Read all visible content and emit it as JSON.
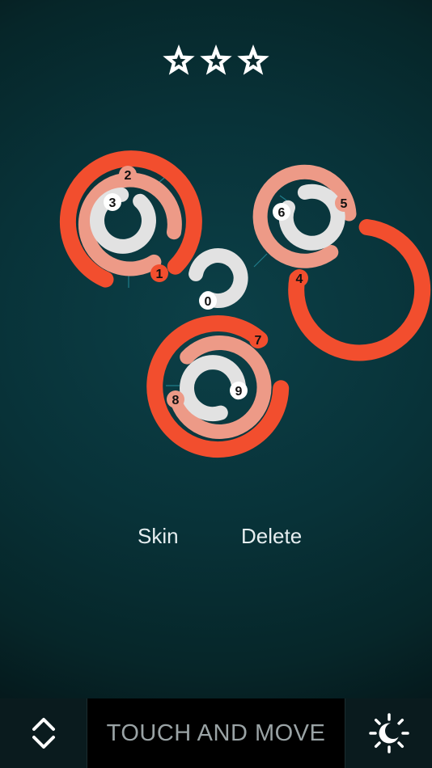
{
  "rating": {
    "stars": 3,
    "max": 5,
    "star_color": "#ffffff"
  },
  "board": {
    "numbers": [
      "0",
      "1",
      "2",
      "3",
      "4",
      "5",
      "6",
      "7",
      "8",
      "9"
    ],
    "colors": {
      "outer": "#f24e2e",
      "mid": "#ed9a87",
      "inner": "#e2e2e2",
      "track_line": "#1f7d8a"
    }
  },
  "actions": {
    "skin_label": "Skin",
    "delete_label": "Delete"
  },
  "bottom_bar": {
    "hint": "TOUCH AND MOVE",
    "left_icon": "chevron-up-down-icon",
    "right_icon": "brightness-icon"
  }
}
